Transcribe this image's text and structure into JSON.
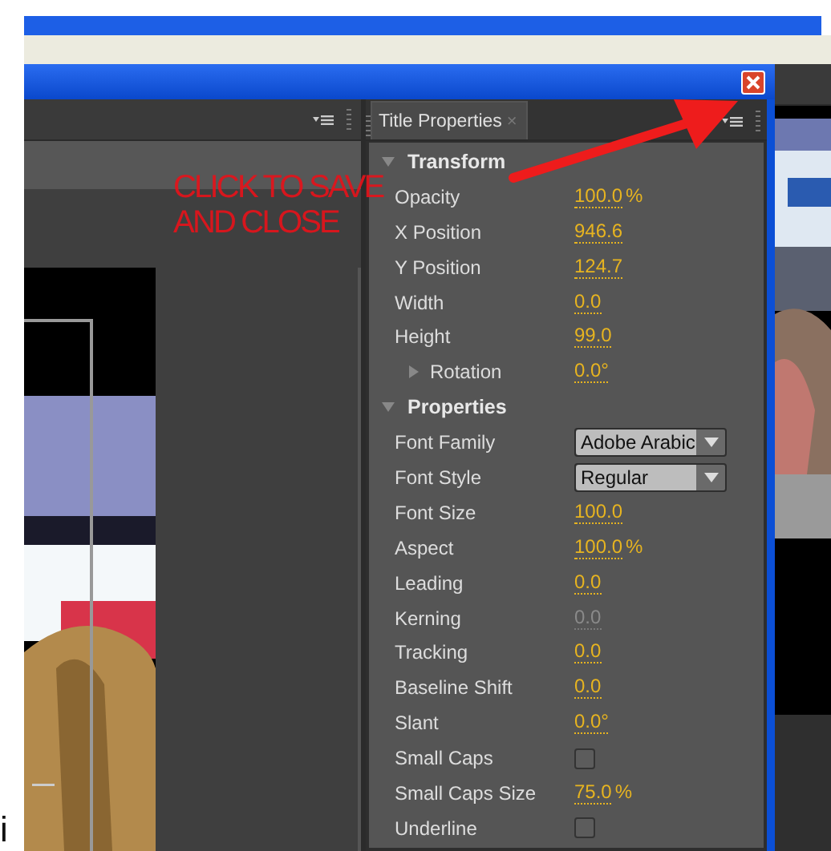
{
  "stray_text": "i",
  "title_panel": {
    "tab": {
      "label": "Title Properties",
      "selected": true
    },
    "tab_close": "×",
    "rows": [
      {
        "kind": "section",
        "label": "Transform",
        "expanded": true
      },
      {
        "kind": "value",
        "label": "Opacity",
        "value": "100.0",
        "unit": "%",
        "disabled": false
      },
      {
        "kind": "value",
        "label": "X Position",
        "value": "946.6",
        "disabled": false
      },
      {
        "kind": "value",
        "label": "Y Position",
        "value": "124.7",
        "disabled": false
      },
      {
        "kind": "value",
        "label": "Width",
        "value": "0.0",
        "disabled": false
      },
      {
        "kind": "value",
        "label": "Height",
        "value": "99.0",
        "disabled": false
      },
      {
        "kind": "subsection",
        "label": "Rotation",
        "value": "0.0°",
        "expanded": false
      },
      {
        "kind": "section",
        "label": "Properties",
        "expanded": true
      },
      {
        "kind": "dropdown",
        "label": "Font Family",
        "value": "Adobe Arabic"
      },
      {
        "kind": "dropdown",
        "label": "Font Style",
        "value": "Regular"
      },
      {
        "kind": "value",
        "label": "Font Size",
        "value": "100.0",
        "disabled": false
      },
      {
        "kind": "value",
        "label": "Aspect",
        "value": "100.0",
        "unit": "%",
        "disabled": false
      },
      {
        "kind": "value",
        "label": "Leading",
        "value": "0.0",
        "disabled": false
      },
      {
        "kind": "value",
        "label": "Kerning",
        "value": "0.0",
        "disabled": true
      },
      {
        "kind": "value",
        "label": "Tracking",
        "value": "0.0",
        "disabled": false
      },
      {
        "kind": "value",
        "label": "Baseline Shift",
        "value": "0.0",
        "disabled": false
      },
      {
        "kind": "value",
        "label": "Slant",
        "value": "0.0°",
        "disabled": false
      },
      {
        "kind": "checkbox",
        "label": "Small Caps",
        "checked": false
      },
      {
        "kind": "value",
        "label": "Small Caps Size",
        "value": "75.0",
        "unit": "%",
        "disabled": false
      },
      {
        "kind": "checkbox",
        "label": "Underline",
        "checked": false
      }
    ]
  },
  "annotation": {
    "lines": [
      "CLICK TO SAVE",
      "AND CLOSE"
    ]
  }
}
